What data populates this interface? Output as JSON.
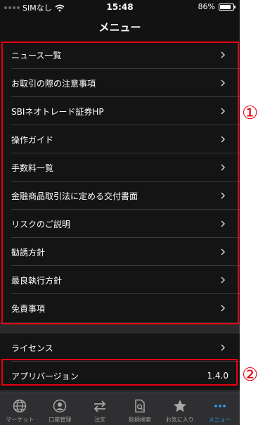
{
  "status_bar": {
    "carrier": "SIMなし",
    "time": "15:48",
    "battery": "86%",
    "battery_level_percent": 86
  },
  "nav": {
    "title": "メニュー"
  },
  "menu_main": [
    {
      "label": "ニュース一覧"
    },
    {
      "label": "お取引の際の注意事項"
    },
    {
      "label": "SBIネオトレード証券HP"
    },
    {
      "label": "操作ガイド"
    },
    {
      "label": "手数料一覧"
    },
    {
      "label": "金融商品取引法に定める交付書面"
    },
    {
      "label": "リスクのご説明"
    },
    {
      "label": "勧誘方針"
    },
    {
      "label": "最良執行方針"
    },
    {
      "label": "免責事項"
    }
  ],
  "menu_sub": {
    "license": {
      "label": "ライセンス"
    },
    "app_version": {
      "label": "アプリバージョン",
      "value": "1.4.0"
    }
  },
  "annotations": {
    "callout_1": "①",
    "callout_2": "②"
  },
  "tab_bar": [
    {
      "label": "マーケット",
      "icon": "globe-icon",
      "active": false
    },
    {
      "label": "口座管理",
      "icon": "user-circle-icon",
      "active": false
    },
    {
      "label": "注文",
      "icon": "swap-arrows-icon",
      "active": false
    },
    {
      "label": "銘柄検索",
      "icon": "document-search-icon",
      "active": false
    },
    {
      "label": "お気に入り",
      "icon": "star-icon",
      "active": false
    },
    {
      "label": "メニュー",
      "icon": "more-dots-icon",
      "active": true
    }
  ],
  "colors": {
    "highlight": "#e60012",
    "active_tab": "#2fa7ff",
    "background": "#141414"
  }
}
